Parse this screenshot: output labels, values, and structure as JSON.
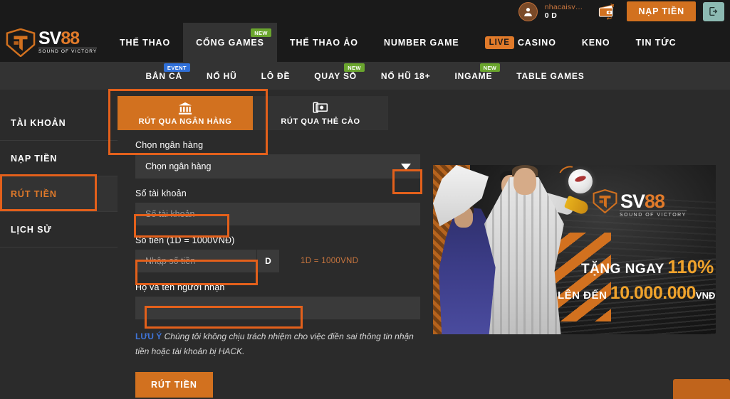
{
  "header": {
    "username": "nhacaisv…",
    "balance": "0 D",
    "avatar_icon": "user-avatar-icon",
    "wallet_icon": "wallet-icon",
    "deposit_label": "NẠP TIỀN",
    "logout_icon": "logout-icon"
  },
  "brand": {
    "name_white": "SV",
    "name_orange": "88",
    "tagline": "SOUND OF VICTORY"
  },
  "mainnav": [
    {
      "label": "THỂ THAO",
      "badge": "",
      "active": false
    },
    {
      "label": "CỔNG GAMES",
      "badge": "NEW",
      "badge_type": "new",
      "active": true
    },
    {
      "label": "THỂ THAO ẢO",
      "badge": "",
      "active": false
    },
    {
      "label": "NUMBER GAME",
      "badge": "",
      "active": false
    },
    {
      "label": "CASINO",
      "tag": "LIVE",
      "badge": "",
      "active": false
    },
    {
      "label": "KENO",
      "badge": "",
      "active": false
    },
    {
      "label": "TIN TỨC",
      "badge": "",
      "active": false
    }
  ],
  "subnav": [
    {
      "label": "BẮN CÁ",
      "badge": "EVENT",
      "badge_type": "event"
    },
    {
      "label": "NỔ HŨ",
      "badge": ""
    },
    {
      "label": "LÔ ĐỀ",
      "badge": ""
    },
    {
      "label": "QUAY SỐ",
      "badge": "NEW",
      "badge_type": "new"
    },
    {
      "label": "NỔ HŨ 18+",
      "badge": ""
    },
    {
      "label": "INGAME",
      "badge": "NEW",
      "badge_type": "new"
    },
    {
      "label": "TABLE GAMES",
      "badge": ""
    }
  ],
  "sidebar": [
    {
      "label": "TÀI KHOẢN",
      "active": false
    },
    {
      "label": "NẠP TIỀN",
      "active": false
    },
    {
      "label": "RÚT TIỀN",
      "active": true
    },
    {
      "label": "LỊCH SỬ",
      "active": false
    }
  ],
  "tabs": [
    {
      "label": "RÚT QUA NGÂN HÀNG",
      "icon": "bank-icon",
      "active": true
    },
    {
      "label": "RÚT QUA THẺ CÀO",
      "icon": "cash-card-icon",
      "active": false
    }
  ],
  "form": {
    "bank_label": "Chọn ngân hàng",
    "bank_value": "Chọn ngân hàng",
    "account_label": "Số tài khoản",
    "account_placeholder": "Số tài khoản",
    "account_value": "",
    "amount_label": "Số tiền (1D = 1000VNĐ)",
    "amount_placeholder": "Nhập số tiền",
    "amount_value": "",
    "amount_suffix": "D",
    "rate_hint": "1D = 1000VND",
    "name_label": "Họ và tên người nhận",
    "name_placeholder": "",
    "name_value": "",
    "note_label": "LƯU Ý",
    "note_text": " Chúng tôi không chịu trách nhiệm cho việc điền sai thông tin nhận tiền hoặc tài khoản bị HACK.",
    "submit_label": "RÚT TIỀN"
  },
  "banner": {
    "logo_white": "SV",
    "logo_orange": "88",
    "logo_sub": "SOUND OF VICTORY",
    "line1_text": "TẶNG NGAY",
    "line1_value": "110%",
    "line2_text": "LÊN ĐẾN",
    "line2_value": "10.000.000",
    "line2_unit": "VNĐ"
  },
  "colors": {
    "accent_orange": "#d2711f",
    "highlight_orange": "#e3601b",
    "badge_green": "#6aa52e",
    "badge_blue": "#2f6fd8",
    "link_blue": "#3f74d8",
    "logout_teal": "#8cb9b2",
    "bg_dark": "#1a1a1a",
    "bg_panel": "#2b2b2b",
    "bg_input": "#3a3a3a"
  }
}
